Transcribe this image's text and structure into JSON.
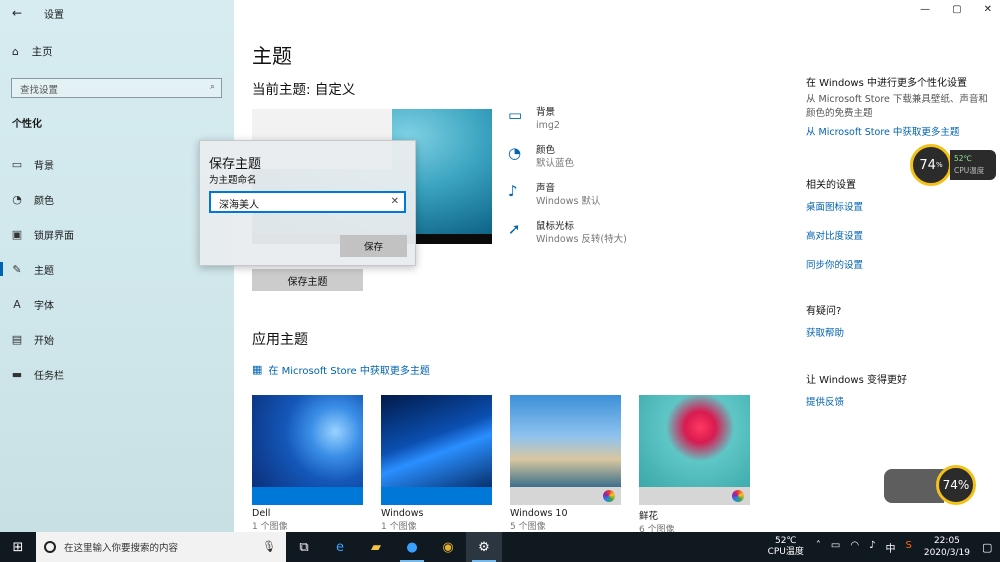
{
  "window": {
    "title": "设置",
    "back": "←",
    "controls": [
      "—",
      "▢",
      "✕"
    ]
  },
  "nav": {
    "home": "主页",
    "search_placeholder": "查找设置",
    "section": "个性化",
    "items": [
      {
        "label": "背景",
        "icon": "image-icon"
      },
      {
        "label": "颜色",
        "icon": "palette-icon"
      },
      {
        "label": "锁屏界面",
        "icon": "lock-screen-icon"
      },
      {
        "label": "主题",
        "icon": "theme-icon"
      },
      {
        "label": "字体",
        "icon": "font-icon"
      },
      {
        "label": "开始",
        "icon": "start-icon"
      },
      {
        "label": "任务栏",
        "icon": "taskbar-icon"
      }
    ]
  },
  "main": {
    "title": "主题",
    "current": "当前主题: 自定义",
    "save_theme": "保存主题",
    "props": [
      {
        "name": "背景",
        "value": "img2"
      },
      {
        "name": "颜色",
        "value": "默认蓝色"
      },
      {
        "name": "声音",
        "value": "Windows 默认"
      },
      {
        "name": "鼠标光标",
        "value": "Windows 反转(特大)"
      }
    ],
    "apply_title": "应用主题",
    "store_link": "在 Microsoft Store 中获取更多主题",
    "themes": [
      {
        "name": "Dell",
        "count": "1 个图像"
      },
      {
        "name": "Windows",
        "count": "1 个图像"
      },
      {
        "name": "Windows 10",
        "count": "5 个图像"
      },
      {
        "name": "鲜花",
        "count": "6 个图像"
      }
    ]
  },
  "right": {
    "more_title": "在 Windows 中进行更多个性化设置",
    "more_text": "从 Microsoft Store 下载兼具壁纸、声音和颜色的免费主题",
    "more_link": "从 Microsoft Store 中获取更多主题",
    "related_title": "相关的设置",
    "related_links": [
      "桌面图标设置",
      "高对比度设置",
      "同步你的设置"
    ],
    "question_title": "有疑问?",
    "help_link": "获取帮助",
    "better_title": "让 Windows 变得更好",
    "feedback_link": "提供反馈"
  },
  "dialog": {
    "title": "保存主题",
    "subtitle": "为主题命名",
    "value": "深海美人",
    "save": "保存"
  },
  "cpu_widget": {
    "percent": "74",
    "pct_sign": "%",
    "temp": "52℃",
    "label": "CPU温度"
  },
  "cpu_widget2": {
    "percent": "74%"
  },
  "taskbar": {
    "search_text": "在这里输入你要搜索的内容",
    "cpu_temp": "52℃",
    "cpu_label": "CPU温度",
    "ime": "中",
    "time": "22:05",
    "date": "2020/3/19"
  }
}
